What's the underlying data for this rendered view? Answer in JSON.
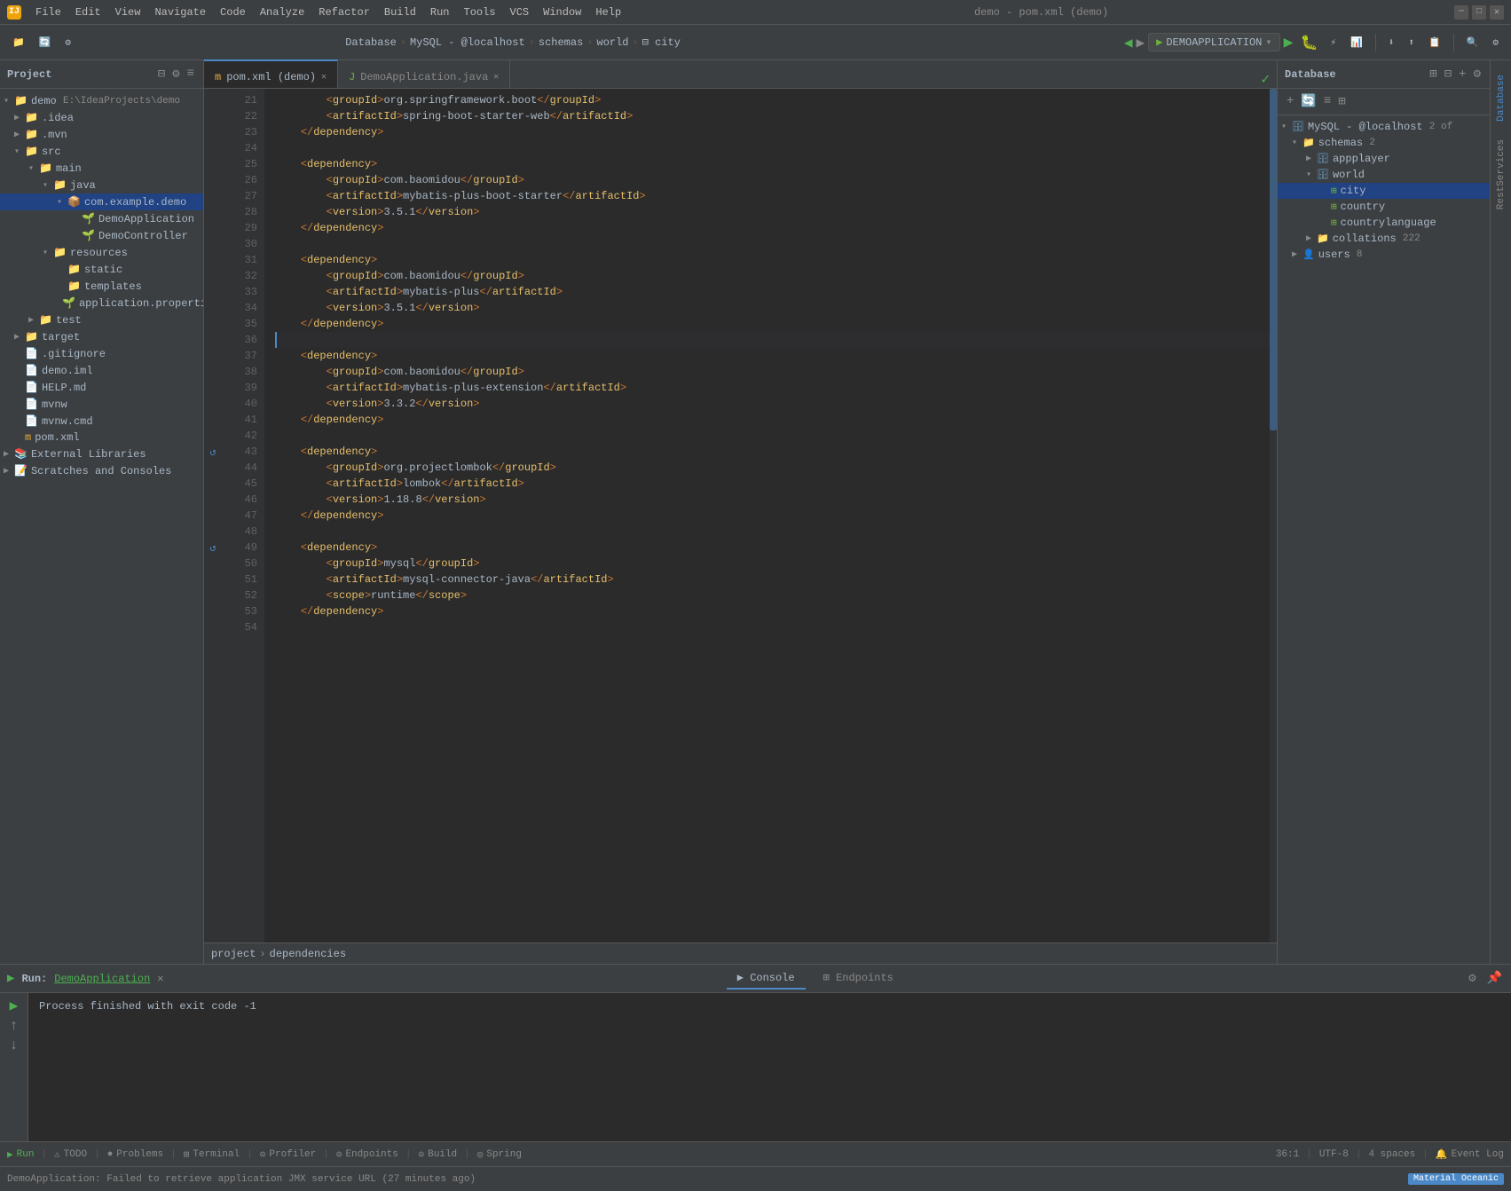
{
  "app": {
    "title": "demo - pom.xml (demo)",
    "icon": "IJ"
  },
  "menu": {
    "items": [
      "File",
      "Edit",
      "View",
      "Navigate",
      "Code",
      "Analyze",
      "Refactor",
      "Build",
      "Run",
      "Tools",
      "VCS",
      "Window",
      "Help"
    ]
  },
  "breadcrumb": {
    "items": [
      "Database",
      "MySQL - @localhost",
      "schemas",
      "world",
      "city"
    ]
  },
  "toolbar": {
    "run_config": "DEMOAPPLICATION",
    "run_label": "▶",
    "debug_label": "🐛"
  },
  "tabs": [
    {
      "label": "pom.xml (demo)",
      "active": true,
      "icon": "m"
    },
    {
      "label": "DemoApplication.java",
      "active": false,
      "icon": "J"
    }
  ],
  "code": {
    "lines": [
      {
        "num": 21,
        "content": "    <groupId>org.springframework.boot</groupId>",
        "type": "xml"
      },
      {
        "num": 22,
        "content": "    <artifactId>spring-boot-starter-web</artifactId>",
        "type": "xml"
      },
      {
        "num": 23,
        "content": "</dependency>",
        "type": "xml"
      },
      {
        "num": 24,
        "content": "",
        "type": "empty"
      },
      {
        "num": 25,
        "content": "<dependency>",
        "type": "xml"
      },
      {
        "num": 26,
        "content": "    <groupId>com.baomidou</groupId>",
        "type": "xml"
      },
      {
        "num": 27,
        "content": "    <artifactId>mybatis-plus-boot-starter</artifactId>",
        "type": "xml"
      },
      {
        "num": 28,
        "content": "    <version>3.5.1</version>",
        "type": "xml"
      },
      {
        "num": 29,
        "content": "</dependency>",
        "type": "xml"
      },
      {
        "num": 30,
        "content": "",
        "type": "empty"
      },
      {
        "num": 31,
        "content": "<dependency>",
        "type": "xml"
      },
      {
        "num": 32,
        "content": "    <groupId>com.baomidou</groupId>",
        "type": "xml"
      },
      {
        "num": 33,
        "content": "    <artifactId>mybatis-plus</artifactId>",
        "type": "xml"
      },
      {
        "num": 34,
        "content": "    <version>3.5.1</version>",
        "type": "xml"
      },
      {
        "num": 35,
        "content": "</dependency>",
        "type": "xml"
      },
      {
        "num": 36,
        "content": "",
        "type": "cursor"
      },
      {
        "num": 37,
        "content": "<dependency>",
        "type": "xml"
      },
      {
        "num": 38,
        "content": "    <groupId>com.baomidou</groupId>",
        "type": "xml"
      },
      {
        "num": 39,
        "content": "    <artifactId>mybatis-plus-extension</artifactId>",
        "type": "xml"
      },
      {
        "num": 40,
        "content": "    <version>3.3.2</version>",
        "type": "xml"
      },
      {
        "num": 41,
        "content": "</dependency>",
        "type": "xml"
      },
      {
        "num": 42,
        "content": "",
        "type": "empty"
      },
      {
        "num": 43,
        "content": "<dependency>",
        "type": "xml",
        "gutter": "update"
      },
      {
        "num": 44,
        "content": "    <groupId>org.projectlombok</groupId>",
        "type": "xml"
      },
      {
        "num": 45,
        "content": "    <artifactId>lombok</artifactId>",
        "type": "xml"
      },
      {
        "num": 46,
        "content": "    <version>1.18.8</version>",
        "type": "xml"
      },
      {
        "num": 47,
        "content": "</dependency>",
        "type": "xml"
      },
      {
        "num": 48,
        "content": "",
        "type": "empty"
      },
      {
        "num": 49,
        "content": "<dependency>",
        "type": "xml",
        "gutter": "update"
      },
      {
        "num": 50,
        "content": "    <groupId>mysql</groupId>",
        "type": "xml"
      },
      {
        "num": 51,
        "content": "    <artifactId>mysql-connector-java</artifactId>",
        "type": "xml"
      },
      {
        "num": 52,
        "content": "    <scope>runtime</scope>",
        "type": "xml"
      },
      {
        "num": 53,
        "content": "</dependency>",
        "type": "xml"
      },
      {
        "num": 54,
        "content": "",
        "type": "empty"
      }
    ]
  },
  "sidebar": {
    "title": "Project",
    "tree": [
      {
        "level": 0,
        "label": "demo  E:\\IdeaProjects\\demo",
        "icon": "project",
        "expanded": true
      },
      {
        "level": 1,
        "label": ".idea",
        "icon": "folder",
        "expanded": false
      },
      {
        "level": 1,
        "label": ".mvn",
        "icon": "folder",
        "expanded": false
      },
      {
        "level": 1,
        "label": "src",
        "icon": "folder",
        "expanded": true
      },
      {
        "level": 2,
        "label": "main",
        "icon": "folder",
        "expanded": true
      },
      {
        "level": 3,
        "label": "java",
        "icon": "folder",
        "expanded": true
      },
      {
        "level": 4,
        "label": "com.example.demo",
        "icon": "package",
        "expanded": true,
        "selected": true
      },
      {
        "level": 5,
        "label": "DemoApplication",
        "icon": "spring"
      },
      {
        "level": 5,
        "label": "DemoController",
        "icon": "spring"
      },
      {
        "level": 3,
        "label": "resources",
        "icon": "folder",
        "expanded": true
      },
      {
        "level": 4,
        "label": "static",
        "icon": "folder"
      },
      {
        "level": 4,
        "label": "templates",
        "icon": "folder"
      },
      {
        "level": 4,
        "label": "application.properties",
        "icon": "spring"
      },
      {
        "level": 2,
        "label": "test",
        "icon": "folder"
      },
      {
        "level": 1,
        "label": "target",
        "icon": "folder",
        "expanded": false
      },
      {
        "level": 1,
        "label": ".gitignore",
        "icon": "file"
      },
      {
        "level": 1,
        "label": "demo.iml",
        "icon": "file"
      },
      {
        "level": 1,
        "label": "HELP.md",
        "icon": "file"
      },
      {
        "level": 1,
        "label": "mvnw",
        "icon": "file"
      },
      {
        "level": 1,
        "label": "mvnw.cmd",
        "icon": "file"
      },
      {
        "level": 1,
        "label": "pom.xml",
        "icon": "xml"
      },
      {
        "level": 0,
        "label": "External Libraries",
        "icon": "folder",
        "expanded": false
      },
      {
        "level": 0,
        "label": "Scratches and Consoles",
        "icon": "folder",
        "expanded": false
      }
    ]
  },
  "database_panel": {
    "title": "Database",
    "tree": [
      {
        "level": 0,
        "label": "MySQL - @localhost",
        "badge": "2 of",
        "expanded": true
      },
      {
        "level": 1,
        "label": "schemas",
        "badge": "2",
        "expanded": true
      },
      {
        "level": 2,
        "label": "appplayer",
        "expanded": false
      },
      {
        "level": 2,
        "label": "world",
        "expanded": true
      },
      {
        "level": 3,
        "label": "city",
        "icon": "table",
        "selected": true
      },
      {
        "level": 3,
        "label": "country",
        "icon": "table"
      },
      {
        "level": 3,
        "label": "countrylanguage",
        "icon": "table"
      },
      {
        "level": 2,
        "label": "collations",
        "badge": "222"
      },
      {
        "level": 1,
        "label": "users",
        "badge": "8"
      }
    ]
  },
  "run_panel": {
    "title": "Run:",
    "app_name": "DemoApplication",
    "tabs": [
      "Console",
      "Endpoints"
    ],
    "active_tab": "Console",
    "output": "Process finished with exit code -1"
  },
  "status_bar": {
    "position": "36:1",
    "encoding": "UTF-8",
    "indent": "4 spaces",
    "event_log": "Event Log",
    "items": [
      "▶ Run",
      "⚠ TODO",
      "● Problems",
      "⊞ Terminal",
      "⊙ Profiler",
      "⊙ Endpoints",
      "⊙ Build",
      "◎ Spring"
    ]
  },
  "footer": {
    "message": "DemoApplication: Failed to retrieve application JMX service URL (27 minutes ago)",
    "theme": "Material Oceanic"
  },
  "breadcrumb_bottom": {
    "items": [
      "project",
      "dependencies"
    ]
  }
}
